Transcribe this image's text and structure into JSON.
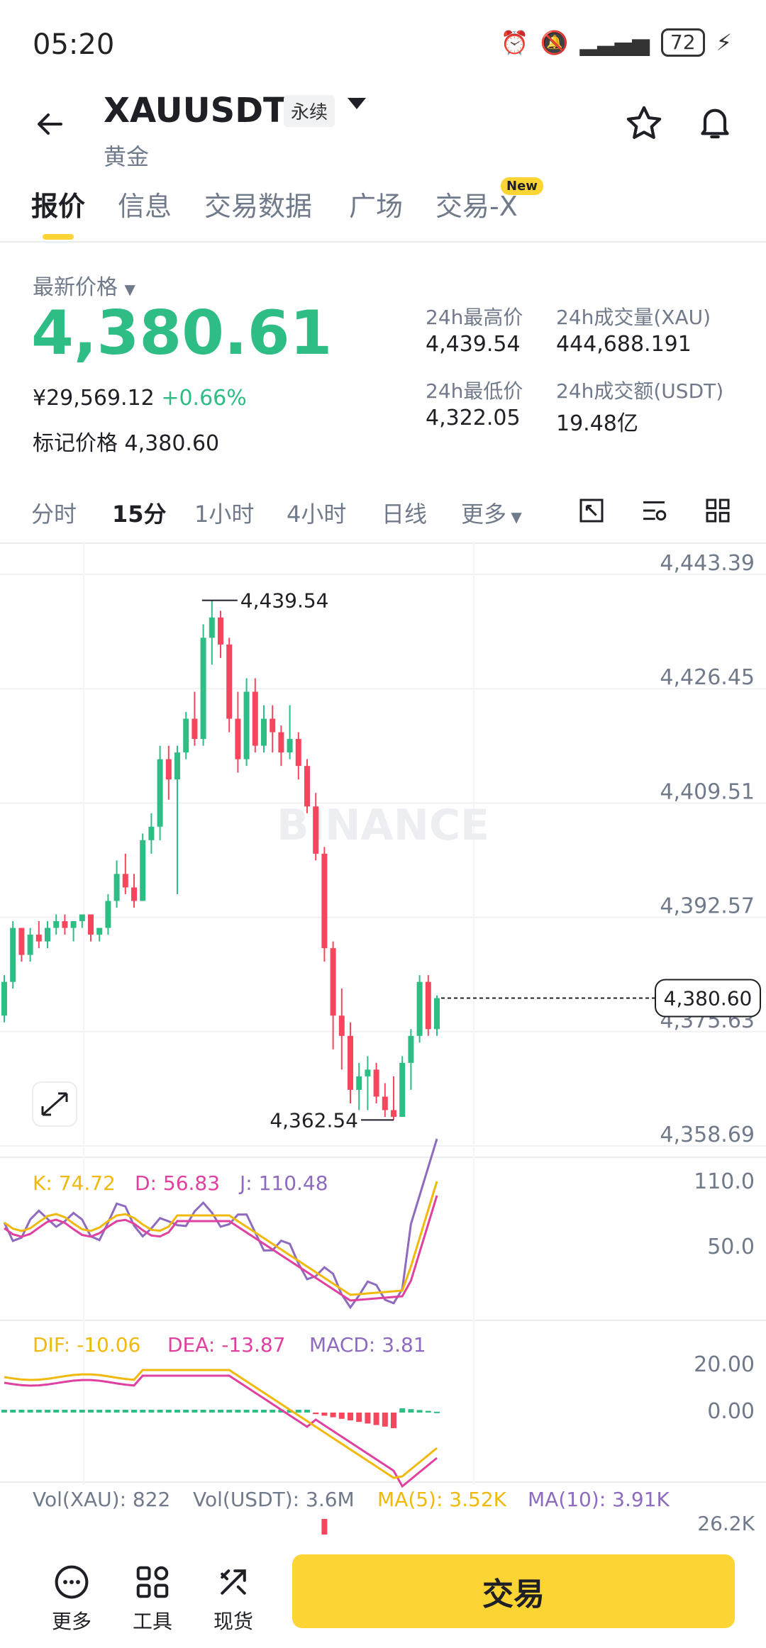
{
  "status_bar": {
    "time": "05:20",
    "battery": "72"
  },
  "header": {
    "symbol": "XAUUSDT",
    "contract_type": "永续",
    "name": "黄金"
  },
  "tabs": [
    {
      "label": "报价",
      "active": true
    },
    {
      "label": "信息"
    },
    {
      "label": "交易数据"
    },
    {
      "label": "广场"
    },
    {
      "label": "交易-X",
      "badge": "New"
    }
  ],
  "price": {
    "label": "最新价格",
    "last": "4,380.61",
    "cny": "¥29,569.12",
    "change": "+0.66%",
    "mark_label": "标记价格",
    "mark_value": "4,380.60"
  },
  "stats": {
    "high_label": "24h最高价",
    "high": "4,439.54",
    "low_label": "24h最低价",
    "low": "4,322.05",
    "vol_label": "24h成交量(XAU)",
    "vol": "444,688.191",
    "amount_label": "24h成交额(USDT)",
    "amount": "19.48亿"
  },
  "intervals": [
    {
      "label": "分时"
    },
    {
      "label": "15分",
      "active": true
    },
    {
      "label": "1小时"
    },
    {
      "label": "4小时"
    },
    {
      "label": "日线"
    },
    {
      "label": "更多"
    }
  ],
  "colors": {
    "up": "#2ebd85",
    "down": "#f6465d",
    "accent": "#fcd535",
    "k": "#f0b90b",
    "d": "#e040a0",
    "j": "#8e6bbf"
  },
  "chart_data": {
    "type": "candlestick",
    "watermark": "BINANCE",
    "y_labels": [
      "4,443.39",
      "4,426.45",
      "4,409.51",
      "4,392.57",
      "4,375.63",
      "4,358.69"
    ],
    "ylim": [
      4358.69,
      4443.39
    ],
    "high_marker": "4,439.54",
    "low_marker": "4,362.54",
    "current_price_tag": "4,380.60",
    "candles": [
      [
        4378,
        4384,
        4377,
        4383
      ],
      [
        4383,
        4392,
        4382,
        4391
      ],
      [
        4391,
        4390,
        4386,
        4387
      ],
      [
        4387,
        4391,
        4386,
        4390
      ],
      [
        4390,
        4392,
        4388,
        4389
      ],
      [
        4389,
        4392,
        4388,
        4391
      ],
      [
        4391,
        4393,
        4390,
        4392
      ],
      [
        4392,
        4393,
        4390,
        4391
      ],
      [
        4391,
        4392,
        4389,
        4392
      ],
      [
        4392,
        4393,
        4391,
        4393
      ],
      [
        4393,
        4393,
        4389,
        4390
      ],
      [
        4390,
        4391,
        4389,
        4391
      ],
      [
        4391,
        4396,
        4390,
        4395
      ],
      [
        4395,
        4401,
        4394,
        4399
      ],
      [
        4399,
        4402,
        4396,
        4397
      ],
      [
        4397,
        4399,
        4394,
        4395
      ],
      [
        4395,
        4405,
        4395,
        4404
      ],
      [
        4404,
        4408,
        4402,
        4406
      ],
      [
        4406,
        4418,
        4404,
        4416
      ],
      [
        4416,
        4418,
        4410,
        4413
      ],
      [
        4413,
        4418,
        4396,
        4417
      ],
      [
        4417,
        4423,
        4416,
        4422
      ],
      [
        4422,
        4426,
        4418,
        4419
      ],
      [
        4419,
        4436,
        4418,
        4434
      ],
      [
        4434,
        4439.54,
        4430,
        4437
      ],
      [
        4437,
        4438,
        4431,
        4433
      ],
      [
        4433,
        4434,
        4420,
        4422
      ],
      [
        4422,
        4426,
        4414,
        4416
      ],
      [
        4416,
        4428,
        4415,
        4426
      ],
      [
        4426,
        4428,
        4417,
        4418
      ],
      [
        4418,
        4424,
        4417,
        4422
      ],
      [
        4422,
        4424,
        4417,
        4420
      ],
      [
        4420,
        4421,
        4415,
        4417
      ],
      [
        4417,
        4424,
        4416,
        4419
      ],
      [
        4419,
        4420,
        4413,
        4415
      ],
      [
        4415,
        4416,
        4408,
        4409
      ],
      [
        4409,
        4411,
        4401,
        4402
      ],
      [
        4402,
        4403,
        4386,
        4388
      ],
      [
        4388,
        4389,
        4373,
        4378
      ],
      [
        4378,
        4382,
        4370,
        4375
      ],
      [
        4375,
        4377,
        4365,
        4367
      ],
      [
        4367,
        4371,
        4364,
        4369
      ],
      [
        4369,
        4372,
        4364,
        4370
      ],
      [
        4370,
        4371,
        4365,
        4366
      ],
      [
        4366,
        4368,
        4363,
        4364
      ],
      [
        4364,
        4369,
        4362.54,
        4363
      ],
      [
        4363,
        4372,
        4363,
        4371
      ],
      [
        4371,
        4376,
        4367,
        4375
      ],
      [
        4375,
        4384,
        4374,
        4383
      ],
      [
        4383,
        4384,
        4375,
        4376
      ],
      [
        4376,
        4381,
        4375,
        4380.6
      ]
    ],
    "kdj": {
      "k_label": "K: 74.72",
      "d_label": "D: 56.83",
      "j_label": "J: 110.48",
      "axis": [
        "110.0",
        "50.0"
      ]
    },
    "macd": {
      "dif_label": "DIF: -10.06",
      "dea_label": "DEA: -13.87",
      "macd_label": "MACD: 3.81",
      "axis": [
        "20.00",
        "0.00"
      ]
    },
    "volume": {
      "vol_xau": "Vol(XAU): 822",
      "vol_usdt": "Vol(USDT): 3.6M",
      "ma5": "MA(5): 3.52K",
      "ma10": "MA(10): 3.91K",
      "axis": "26.2K"
    }
  },
  "bottom_bar": {
    "more": "更多",
    "tools": "工具",
    "spot": "现货",
    "trade": "交易"
  }
}
